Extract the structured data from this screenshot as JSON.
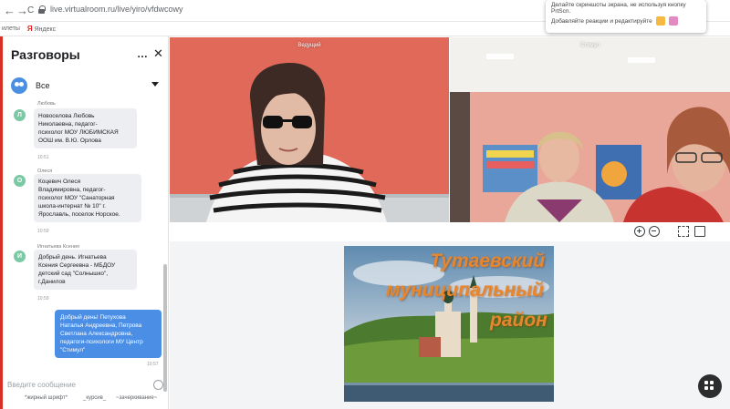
{
  "browser": {
    "url": "live.virtualroom.ru/live/yiro/vfdwcowy",
    "back": "←",
    "forward": "→",
    "reload": "C",
    "bookmarks": [
      "илеты",
      "Яндекс"
    ],
    "notification": {
      "line1": "Делайте скриншоты экрана, не используя кнопку PrtScn.",
      "line2": "Добавляйте реакции и редактируйте"
    }
  },
  "sidebar": {
    "title": "Разговоры",
    "menu_icon": "…",
    "close_icon": "✕",
    "filter_label": "Все",
    "messages": [
      {
        "author": "Любовь",
        "initial": "Л",
        "lines": [
          "Новоселова Любовь",
          "Николаевна, педагог-",
          "психолог МОУ ЛЮБИМСКАЯ",
          "ООШ им. В.Ю. Орлова"
        ],
        "time": "10:51"
      },
      {
        "author": "Олеся",
        "initial": "О",
        "lines": [
          "Коцевич Олеся",
          "Владимировна, педагог-",
          "психолог МОУ \"Санаторная",
          "школа-интернат № 10\" г.",
          "Ярославль, поселок Норское."
        ],
        "time": "10:59"
      },
      {
        "author": "Игнатьева Ксения",
        "initial": "И",
        "lines": [
          "Добрый день. Игнатьева",
          "Ксения Сергеевна - МБДОУ",
          "детский сад \"Солнышко\",",
          "г.Данилов"
        ],
        "time": "10:59"
      },
      {
        "author": "",
        "initial": "",
        "lines": [
          "Добрый день! Петухова",
          "Наталья Андреевна, Петрова",
          "Светлана Александровна,",
          "педагоги-психологи МУ Центр",
          "\"Стимул\""
        ],
        "time": "10:57"
      }
    ],
    "compose_placeholder": "Введите сообщение",
    "format_buttons": [
      "*жирный шрифт*",
      "_курсив_",
      "~зачеркивание~"
    ]
  },
  "video": {
    "tile1_label": "Ведущий",
    "tile2_label": "Стимул"
  },
  "slide": {
    "title_lines": [
      "Тутаевский",
      "муниципальный",
      "район"
    ]
  },
  "colors": {
    "accent": "#4a8ee6",
    "brand_red": "#d93025"
  }
}
